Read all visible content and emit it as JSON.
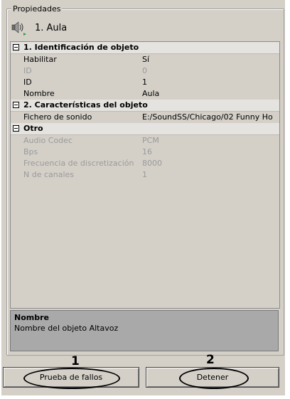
{
  "panel": {
    "group_title": "Propiedades",
    "object_title": "1. Aula",
    "icon": "speaker-icon"
  },
  "categories": [
    {
      "title": "1. Identificación de objeto",
      "props": [
        {
          "name": "Habilitar",
          "value": "Sí",
          "disabled": false
        },
        {
          "name": "ID",
          "value": "0",
          "disabled": true
        },
        {
          "name": "ID",
          "value": "1",
          "disabled": false
        },
        {
          "name": "Nombre",
          "value": "Aula",
          "disabled": false
        }
      ]
    },
    {
      "title": "2. Características del objeto",
      "props": [
        {
          "name": "Fichero de sonido",
          "value": "E:/SoundSS/Chicago/02 Funny Ho",
          "disabled": false
        }
      ]
    },
    {
      "title": "Otro",
      "props": [
        {
          "name": "Audio Codec",
          "value": "PCM",
          "disabled": true
        },
        {
          "name": "Bps",
          "value": "16",
          "disabled": true
        },
        {
          "name": "Frecuencia de discretización",
          "value": "8000",
          "disabled": true
        },
        {
          "name": "N de canales",
          "value": "1",
          "disabled": true
        }
      ]
    }
  ],
  "description": {
    "title": "Nombre",
    "text": "Nombre del objeto Altavoz"
  },
  "buttons": {
    "test_label": "Prueba de fallos",
    "stop_label": "Detener"
  },
  "callouts": {
    "one": "1",
    "two": "2"
  }
}
